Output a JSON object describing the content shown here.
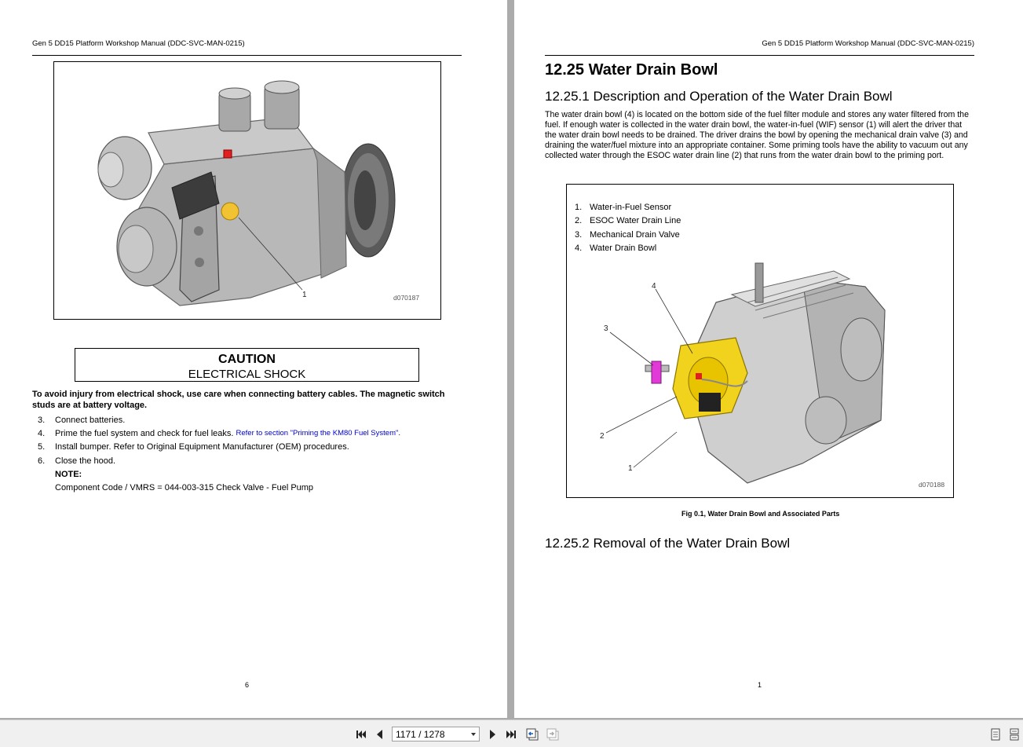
{
  "left_page": {
    "running_header": "Gen 5 DD15 Platform Workshop Manual (DDC-SVC-MAN-0215)",
    "figure": {
      "id": "d070187",
      "callouts": [
        "1"
      ]
    },
    "caution": {
      "title": "CAUTION",
      "subtitle": "ELECTRICAL SHOCK"
    },
    "warning_text": "To avoid injury from electrical shock, use care when connecting battery cables. The magnetic switch studs are at battery voltage.",
    "steps": [
      {
        "num": "3.",
        "text": "Connect batteries."
      },
      {
        "num": "4.",
        "text": "Prime the fuel system and check for fuel leaks.",
        "link": "Refer to section \"Priming the KM80 Fuel System\"",
        "after": " ."
      },
      {
        "num": "5.",
        "text": "Install bumper. Refer to Original Equipment Manufacturer (OEM) procedures."
      },
      {
        "num": "6.",
        "text": "Close the hood."
      }
    ],
    "note_label": "NOTE:",
    "note_text": "Component Code / VMRS = 044-003-315 Check Valve - Fuel Pump",
    "page_number": "6"
  },
  "right_page": {
    "running_header": "Gen 5 DD15 Platform Workshop Manual (DDC-SVC-MAN-0215)",
    "section_title": "12.25 Water Drain Bowl",
    "subsection_1": "12.25.1 Description and Operation of the Water Drain Bowl",
    "body_text": "The water drain bowl (4) is located on the bottom side of the fuel filter module and stores any water filtered from the fuel. If enough water is collected in the water drain bowl, the water-in-fuel (WIF) sensor (1) will alert the driver that the water drain bowl needs to be drained. The driver drains the bowl by opening the mechanical drain valve (3) and draining the water/fuel mixture into an appropriate container. Some priming tools have the ability to vacuum out any collected water through the ESOC water drain line (2) that runs from the water drain bowl to the priming port.",
    "figure": {
      "legend": [
        {
          "num": "1.",
          "label": "Water-in-Fuel Sensor"
        },
        {
          "num": "2.",
          "label": "ESOC Water Drain Line"
        },
        {
          "num": "3.",
          "label": "Mechanical Drain Valve"
        },
        {
          "num": "4.",
          "label": "Water Drain Bowl"
        }
      ],
      "callouts": [
        "4",
        "3",
        "2",
        "1"
      ],
      "id": "d070188"
    },
    "caption": "Fig 0.1,  Water Drain Bowl and Associated Parts",
    "subsection_2": "12.25.2 Removal of the Water Drain Bowl",
    "page_number": "1"
  },
  "toolbar": {
    "page_indicator": "1171 / 1278",
    "icons": [
      "first-page-icon",
      "previous-page-icon",
      "next-page-icon",
      "last-page-icon",
      "previous-view-icon",
      "next-view-icon",
      "single-page-view-icon",
      "continuous-view-icon"
    ]
  }
}
